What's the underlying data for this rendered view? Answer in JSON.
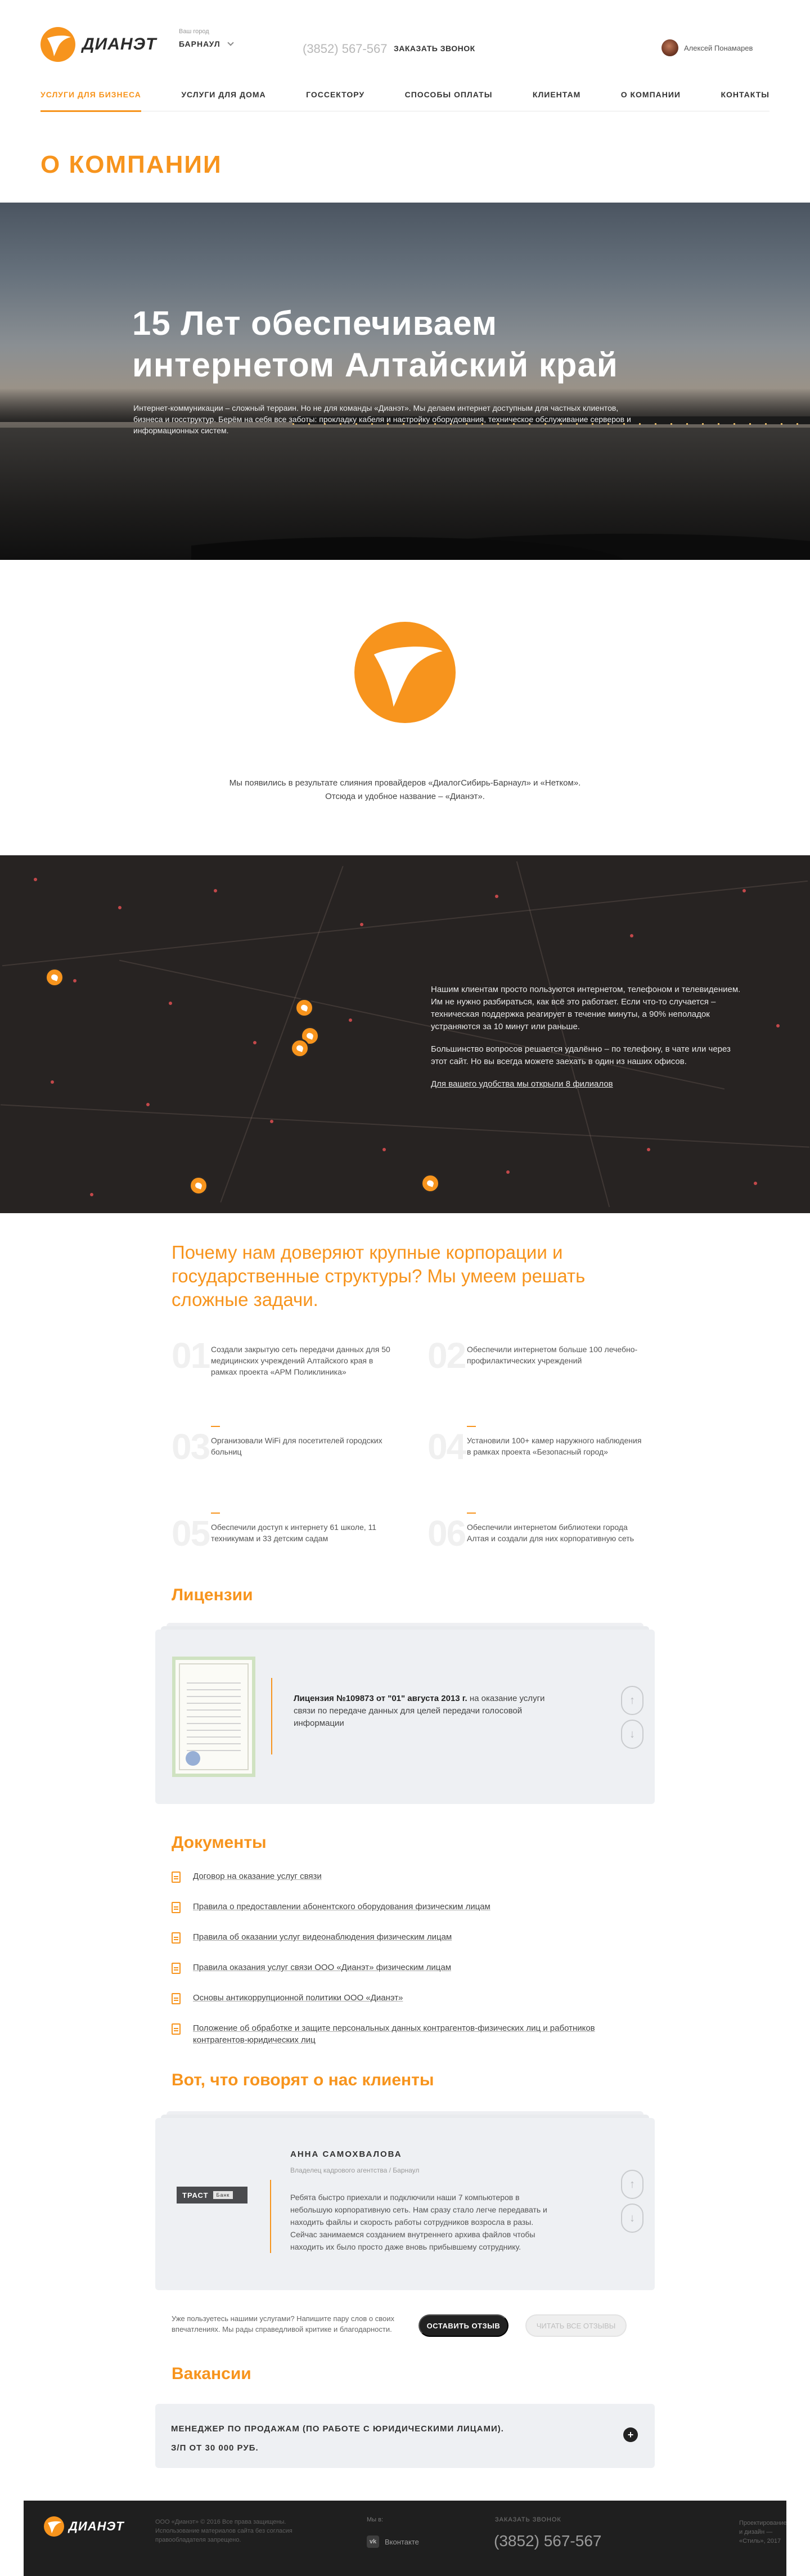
{
  "header": {
    "logo_text": "ДИАНЭТ",
    "city_caption": "Ваш город",
    "city": "БАРНАУЛ",
    "phone": "(3852) 567-567",
    "order_call": "ЗАКАЗАТЬ ЗВОНОК",
    "user_name": "Алексей Понамарев"
  },
  "nav": {
    "items": [
      {
        "label": "УСЛУГИ ДЛЯ БИЗНЕСА",
        "active": true
      },
      {
        "label": "УСЛУГИ ДЛЯ ДОМА"
      },
      {
        "label": "ГОССЕКТОРУ"
      },
      {
        "label": "СПОСОБЫ ОПЛАТЫ"
      },
      {
        "label": "КЛИЕНТАМ"
      },
      {
        "label": "О КОМПАНИИ"
      },
      {
        "label": "КОНТАКТЫ"
      }
    ]
  },
  "page_title": "О КОМПАНИИ",
  "hero": {
    "title": "15 Лет обеспечиваем интернетом Алтайский край",
    "text": "Интернет-коммуникации – сложный терраин. Но не для команды «Дианэт». Мы делаем интернет доступным для частных клиентов, бизнеса и госструктур. Берём на себя все заботы: прокладку кабеля и настройку оборудования, техническое обслуживание серверов и информационных систем."
  },
  "about": {
    "line1": "Мы появились в результате слияния провайдеров «ДиалогСибирь-Барнаул» и «Нетком».",
    "line2": "Отсюда и удобное название – «Дианэт»."
  },
  "map": {
    "p1": "Нашим клиентам просто пользуются интернетом, телефоном и телевидением. Им не нужно разбираться, как всё это работает. Если что-то случается – техническая поддержка реагирует в течение минуты, а 90% неполадок устраняются за 10 минут или раньше.",
    "p2": "Большинство вопросов решается удалённо – по телефону, в чате или через этот сайт. Но вы всегда можете заехать в один из наших офисов.",
    "link": "Для вашего удобства мы открыли 8 филиалов"
  },
  "trust": {
    "title": "Почему нам доверяют крупные корпорации и государственные структуры? Мы умеем решать сложные задачи.",
    "items": [
      {
        "num": "01",
        "text": "Создали закрытую сеть передачи данных для 50 медицинских учреждений Алтайского края в рамках проекта «АРМ Поликлиника»"
      },
      {
        "num": "02",
        "text": "Обеспечили интернетом больше 100 лечебно-профилактических учреждений"
      },
      {
        "num": "03",
        "text": "Организовали WiFi для посетителей городских больниц"
      },
      {
        "num": "04",
        "text": "Установили 100+ камер наружного наблюдения в рамках проекта «Безопасный город»"
      },
      {
        "num": "05",
        "text": "Обеспечили доступ к интернету 61 школе, 11 техникумам и 33 детским садам"
      },
      {
        "num": "06",
        "text": "Обеспечили интернетом библиотеки города Алтая и создали для них корпоративную сеть"
      }
    ]
  },
  "licenses": {
    "heading": "Лицензии",
    "title": "Лицензия №109873 от \"01\" августа 2013 г.",
    "text": " на оказание услуги связи по передаче данных для целей передачи голосовой информации"
  },
  "documents": {
    "heading": "Документы",
    "items": [
      "Договор на оказание услуг связи",
      "Правила о предоставлении абонентского оборудования физическим лицам",
      "Правила об оказании услуг видеонаблюдения физическим лицам",
      "Правила оказания услуг связи ООО «Дианэт» физическим лицам",
      "Основы антикоррупционной политики ООО «Дианэт»",
      "Положение об обработке и защите персональных данных контрагентов-физических лиц и работников контрагентов-юридических лиц"
    ]
  },
  "reviews": {
    "heading": "Вот, что говорят о нас клиенты",
    "company_logo": "ТРАСТ",
    "company_logo_sub": "Банк",
    "name": "АННА САМОХВАЛОВА",
    "role": "Владелец кадрового агентства / Барнаул",
    "text": "Ребята быстро приехали и подключили наши 7 компьютеров в небольшую корпоративную сеть. Нам сразу стало легче передавать и находить файлы и скорость работы сотрудников возросла в разы. Сейчас занимаемся созданием внутреннего архива файлов чтобы находить их было просто даже вновь прибывшему сотруднику.",
    "cta_text": "Уже пользуетесь нашими услугами? Напишите пару слов о своих впечатлениях. Мы рады справедливой критике и благодарности.",
    "leave_review": "ОСТАВИТЬ ОТЗЫВ",
    "read_all": "ЧИТАТЬ ВСЕ ОТЗЫВЫ"
  },
  "vacancies": {
    "heading": "Вакансии",
    "title": "МЕНЕДЖЕР ПО ПРОДАЖАМ (ПО РАБОТЕ С ЮРИДИЧЕСКИМИ ЛИЦАМИ).",
    "salary": "З/П ОТ 30 000 РУБ.",
    "toggle": "+"
  },
  "footer": {
    "logo_text": "ДИАНЭТ",
    "copyright": "ООО «Дианэт» © 2016 Все права защищены. Использование материалов сайта без согласия правообладателя запрещено.",
    "we_in": "Мы в:",
    "vk_icon_text": "vk",
    "vk_label": "Вконтакте",
    "order_call": "ЗАКАЗАТЬ ЗВОНОК",
    "phone": "(3852) 567-567",
    "design": "Проектирование и дизайн — «Стиль», 2017"
  },
  "colors": {
    "accent": "#f7941d",
    "dark": "#222222",
    "card": "#eef0f3"
  }
}
